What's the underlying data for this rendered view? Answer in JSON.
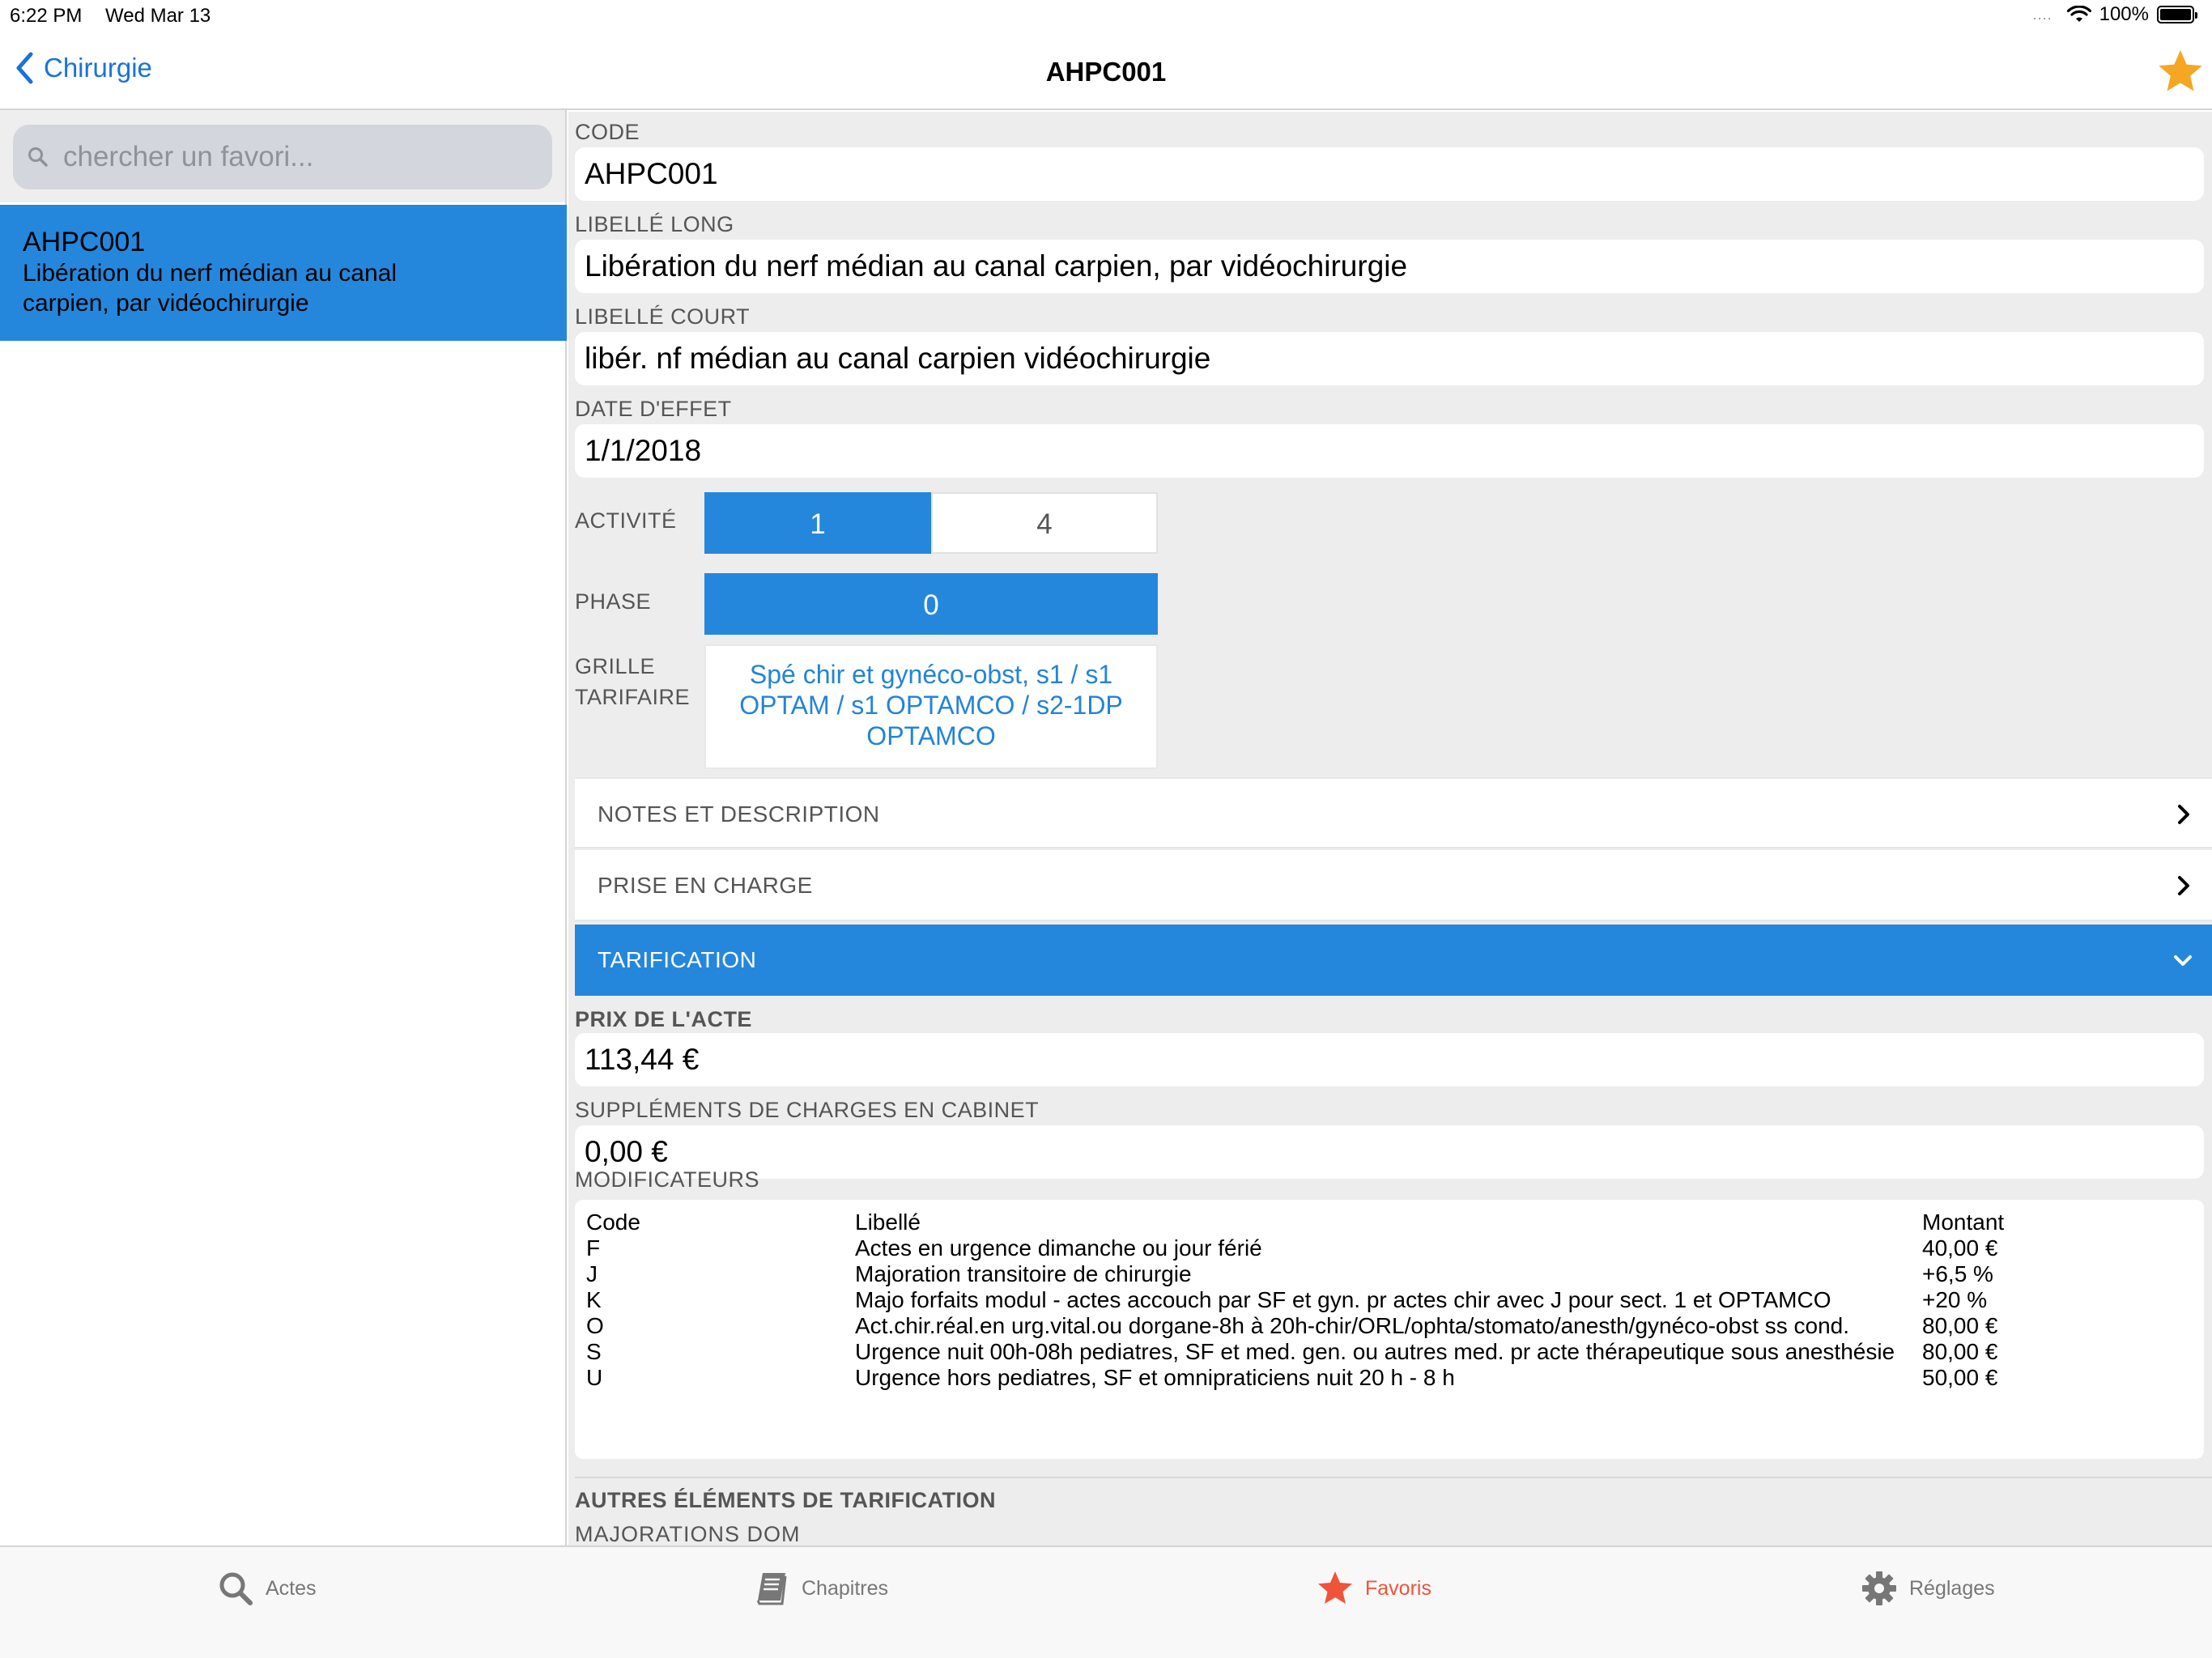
{
  "status_bar": {
    "time": "6:22 PM",
    "date": "Wed Mar 13",
    "signal": "....",
    "battery": "100%"
  },
  "nav": {
    "back_label": "Chirurgie",
    "title": "AHPC001"
  },
  "sidebar": {
    "search_placeholder": "chercher un favori...",
    "items": [
      {
        "code": "AHPC001",
        "label": "Libération du nerf médian au canal carpien, par vidéochirurgie"
      }
    ]
  },
  "detail": {
    "code_label": "CODE",
    "code": "AHPC001",
    "libelle_long_label": "LIBELLÉ LONG",
    "libelle_long": "Libération du nerf médian au canal carpien, par vidéochirurgie",
    "libelle_court_label": "LIBELLÉ COURT",
    "libelle_court": "libér. nf médian au canal carpien vidéochirurgie",
    "date_label": "DATE D'EFFET",
    "date": "1/1/2018",
    "activite_label": "ACTIVITÉ",
    "activite_options": [
      "1",
      "4"
    ],
    "phase_label": "PHASE",
    "phase_options": [
      "0"
    ],
    "grille_label_1": "GRILLE",
    "grille_label_2": "TARIFAIRE",
    "grille_value": "Spé chir et gynéco-obst, s1 /  s1 OPTAM / s1 OPTAMCO / s2-1DP OPTAMCO",
    "sections": [
      "NOTES ET DESCRIPTION",
      "PRISE EN CHARGE",
      "TARIFICATION"
    ],
    "prix_label": "PRIX DE L'ACTE",
    "prix": "113,44 €",
    "supplements_label": "SUPPLÉMENTS DE CHARGES EN CABINET",
    "supplements": "0,00 €",
    "modificateurs_label": "MODIFICATEURS",
    "modificateurs_headers": [
      "Code",
      "Libellé",
      "Montant"
    ],
    "modificateurs": [
      {
        "code": "F",
        "libelle": "Actes en urgence dimanche ou jour férié",
        "montant": "40,00 €"
      },
      {
        "code": "J",
        "libelle": "Majoration transitoire de chirurgie",
        "montant": "+6,5 %"
      },
      {
        "code": "K",
        "libelle": "Majo forfaits modul - actes accouch par SF et gyn. pr actes chir avec J pour sect. 1 et OPTAMCO",
        "montant": "+20 %"
      },
      {
        "code": "O",
        "libelle": "Act.chir.réal.en urg.vital.ou dorgane-8h à 20h-chir/ORL/ophta/stomato/anesth/gynéco-obst ss cond.",
        "montant": "80,00 €"
      },
      {
        "code": "S",
        "libelle": "Urgence nuit 00h-08h pediatres, SF et med. gen. ou autres med. pr acte thérapeutique sous anesthésie",
        "montant": "80,00 €"
      },
      {
        "code": "U",
        "libelle": "Urgence hors pediatres, SF et omnipraticiens nuit 20 h - 8 h",
        "montant": "50,00 €"
      }
    ],
    "autres_label": "AUTRES ÉLÉMENTS DE TARIFICATION",
    "cut_label": "MAJORATIONS DOM"
  },
  "tabbar": {
    "tabs": [
      {
        "label": "Actes",
        "icon": "search-icon"
      },
      {
        "label": "Chapitres",
        "icon": "book-icon"
      },
      {
        "label": "Favoris",
        "icon": "star-icon"
      },
      {
        "label": "Réglages",
        "icon": "gear-icon"
      }
    ]
  },
  "colors": {
    "accent": "#2587dc",
    "link": "#1a73d9",
    "star": "#f5a623",
    "tab_active": "#f0533a"
  }
}
